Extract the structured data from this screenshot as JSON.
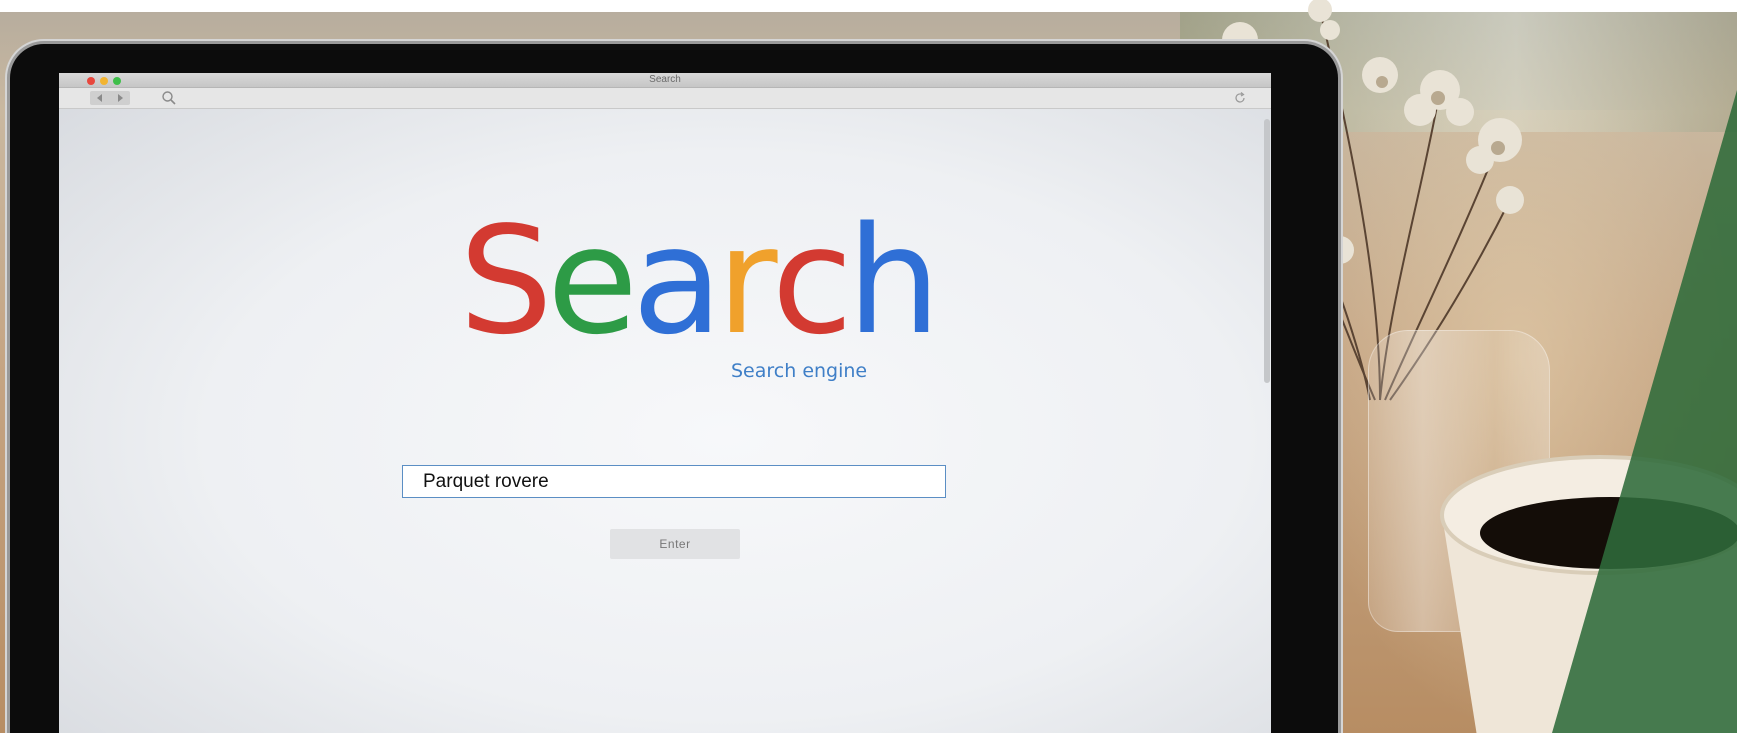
{
  "browser": {
    "title": "Search",
    "nav_back_icon": "chevron-left-icon",
    "nav_forward_icon": "chevron-right-icon",
    "search_icon": "magnifier-icon",
    "reload_icon": "reload-icon",
    "window_controls": [
      "#e8473d",
      "#f2b431",
      "#3fbf4a"
    ]
  },
  "search_page": {
    "logo_letters": [
      {
        "char": "S",
        "color": "#d33a31"
      },
      {
        "char": "e",
        "color": "#2d9b46"
      },
      {
        "char": "a",
        "color": "#2f6fd6"
      },
      {
        "char": "r",
        "color": "#f0a12c"
      },
      {
        "char": "c",
        "color": "#d33a31"
      },
      {
        "char": "h",
        "color": "#2f6fd6"
      }
    ],
    "tagline": "Search engine",
    "query_value": "Parquet rovere",
    "enter_label": "Enter"
  },
  "colors": {
    "overlay_green": "#2f6b3a",
    "input_border": "#5b8ec4",
    "tagline": "#3f7fc7"
  }
}
